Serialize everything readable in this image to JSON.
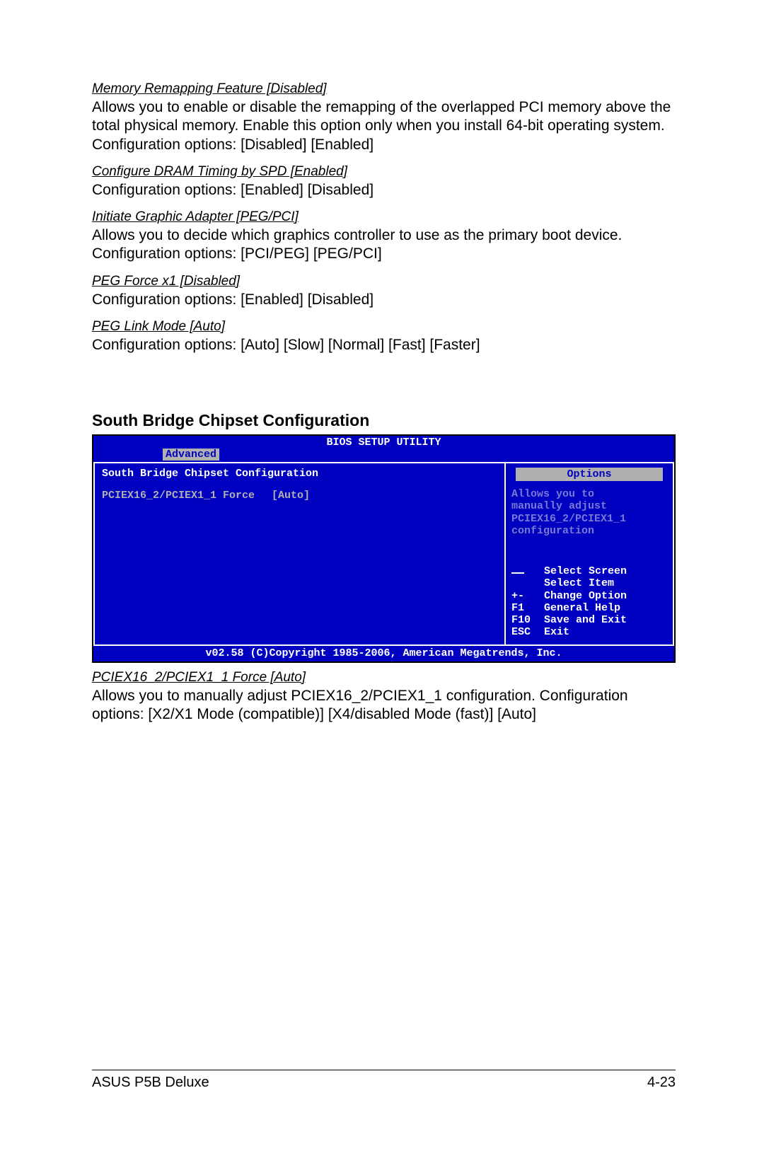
{
  "settings": [
    {
      "title": "Memory Remapping Feature [Disabled]",
      "body": "Allows you to enable or disable the remapping of the overlapped PCI memory above the total physical memory. Enable this option only when you install 64-bit operating system.\nConfiguration options: [Disabled] [Enabled]"
    },
    {
      "title": "Configure DRAM Timing by SPD [Enabled]",
      "body": "Configuration options: [Enabled] [Disabled]"
    },
    {
      "title": "Initiate Graphic Adapter [PEG/PCI]",
      "body": "Allows you to decide which graphics controller to use as the primary boot device. Configuration options: [PCI/PEG] [PEG/PCI]"
    },
    {
      "title": "PEG Force x1 [Disabled]",
      "body": "Configuration options: [Enabled] [Disabled]"
    },
    {
      "title": "PEG Link Mode [Auto]",
      "body": "Configuration options: [Auto] [Slow] [Normal] [Fast] [Faster]"
    }
  ],
  "section_heading": "South Bridge Chipset Configuration",
  "bios": {
    "title": "BIOS SETUP UTILITY",
    "tab": "Advanced",
    "left_header": "South Bridge Chipset Configuration",
    "option_name": "PCIEX16_2/PCIEX1_1 Force",
    "option_value": "[Auto]",
    "right_badge": "Options",
    "help_lines": "Allows you to\nmanually adjust\nPCIEX16_2/PCIEX1_1\nconfiguration",
    "nav": [
      {
        "key": "",
        "label": "Select Screen",
        "sep": true
      },
      {
        "key": "",
        "label": "Select Item"
      },
      {
        "key": "+-",
        "label": "Change Option"
      },
      {
        "key": "F1",
        "label": "General Help"
      },
      {
        "key": "F10",
        "label": "Save and Exit"
      },
      {
        "key": "ESC",
        "label": "Exit"
      }
    ],
    "footer": "v02.58 (C)Copyright 1985-2006, American Megatrends, Inc."
  },
  "post_setting": {
    "title": "PCIEX16_2/PCIEX1_1 Force [Auto]",
    "body": "Allows you to manually adjust PCIEX16_2/PCIEX1_1 configuration. Configuration options: [X2/X1 Mode (compatible)] [X4/disabled Mode (fast)] [Auto]"
  },
  "footer_left": "ASUS P5B Deluxe",
  "footer_right": "4-23"
}
